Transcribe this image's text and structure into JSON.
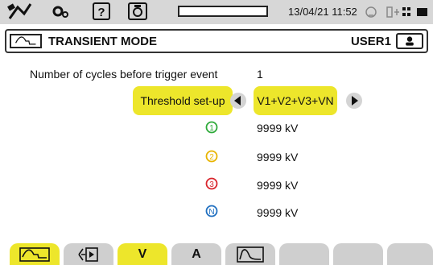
{
  "status_bar": {
    "datetime": "13/04/21 11:52",
    "progress_fraction": 0,
    "icons": [
      "satellite-icon",
      "settings-icon",
      "help-icon",
      "camera-icon",
      "sync-icon",
      "network-icon",
      "battery-icon"
    ]
  },
  "header": {
    "title": "TRANSIENT MODE",
    "user": "USER1",
    "icons": [
      "transient-mode-icon",
      "user-icon"
    ]
  },
  "settings": {
    "cycles_label": "Number of cycles before trigger event",
    "cycles_value": "1",
    "threshold_label": "Threshold set-up",
    "threshold_value": "V1+V2+V3+VN"
  },
  "channels": [
    {
      "symbol": "1",
      "color": "#2eaa3a",
      "value": "9999 kV"
    },
    {
      "symbol": "2",
      "color": "#e8b400",
      "value": "9999 kV"
    },
    {
      "symbol": "3",
      "color": "#d9252d",
      "value": "9999 kV"
    },
    {
      "symbol": "N",
      "color": "#1f6fc0",
      "value": "9999 kV"
    }
  ],
  "tabs": {
    "tab1_icon": "transient-wave-icon",
    "tab2_icon": "capture-icon",
    "tab3_label": "V",
    "tab4_label": "A",
    "tab5_icon": "envelope-icon"
  },
  "colors": {
    "accent": "#ede62b",
    "topbar": "#d7d7d7",
    "tab_inactive": "#cfcfcf"
  }
}
